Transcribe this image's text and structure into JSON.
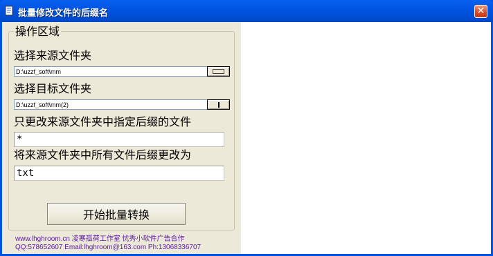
{
  "window": {
    "title": "批量修改文件的后缀名",
    "close_symbol": "✕",
    "accent_color": "#0054e3"
  },
  "group": {
    "title": "操作区域",
    "source_label": "选择来源文件夹",
    "source_path": "D:\\uzzf_soft\\mm",
    "target_label": "选择目标文件夹",
    "target_path": "D:\\uzzf_soft\\mm(2)",
    "filter_label": "只更改来源文件夹中指定后缀的文件",
    "filter_value": "*",
    "rename_label": "将来源文件夹中所有文件后缀更改为",
    "rename_value": "txt",
    "start_button": "开始批量转换"
  },
  "footer": {
    "line1": "www.lhghroom.cn 凌寒孤荷工作室 忧秀小软件广告合作",
    "line2": "QQ:578652607 Email:lhghroom@163.com Ph:13068336707"
  }
}
